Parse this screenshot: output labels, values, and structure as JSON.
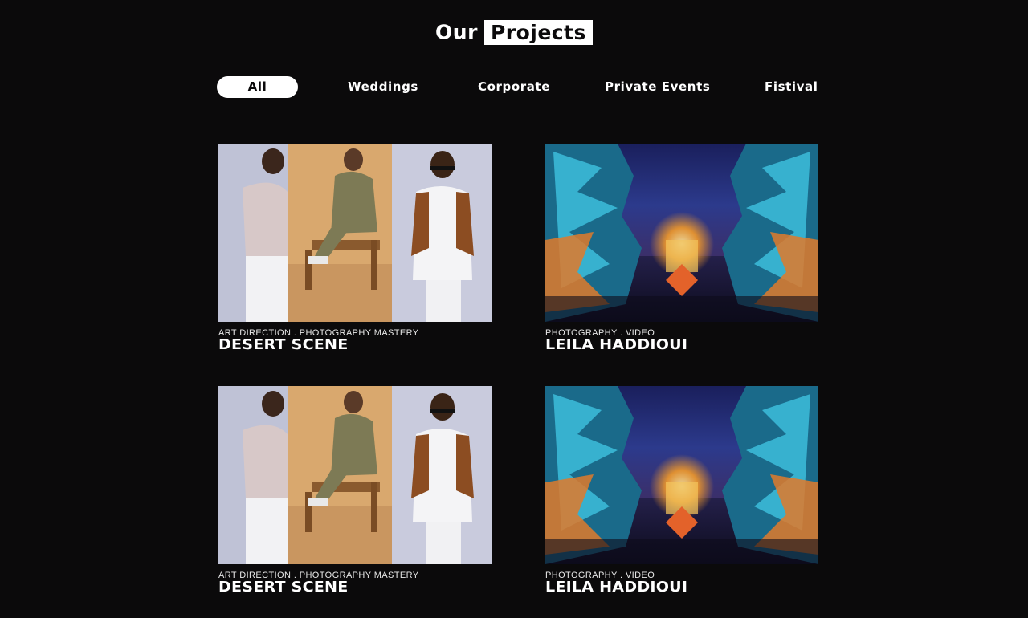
{
  "header": {
    "title_plain": "Our",
    "title_boxed": "Projects"
  },
  "filters": {
    "items": [
      {
        "label": "All",
        "active": true
      },
      {
        "label": "Weddings",
        "active": false
      },
      {
        "label": "Corporate",
        "active": false
      },
      {
        "label": "Private Events",
        "active": false
      },
      {
        "label": "Fistival",
        "active": false
      }
    ]
  },
  "projects": [
    {
      "categories": "ART DIRECTION . PHOTOGRAPHY MASTERY",
      "title": "DESERT SCENE",
      "image": "fashion-triptych-photo"
    },
    {
      "categories": "PHOTOGRAPHY . VIDEO",
      "title": "LEILA HADDIOUI",
      "image": "neon-palm-night-photo"
    },
    {
      "categories": "ART DIRECTION . PHOTOGRAPHY MASTERY",
      "title": "DESERT SCENE",
      "image": "fashion-triptych-photo"
    },
    {
      "categories": "PHOTOGRAPHY . VIDEO",
      "title": "LEILA HADDIOUI",
      "image": "neon-palm-night-photo"
    }
  ],
  "colors": {
    "background": "#0b0a0b",
    "accent": "#ffffff"
  }
}
